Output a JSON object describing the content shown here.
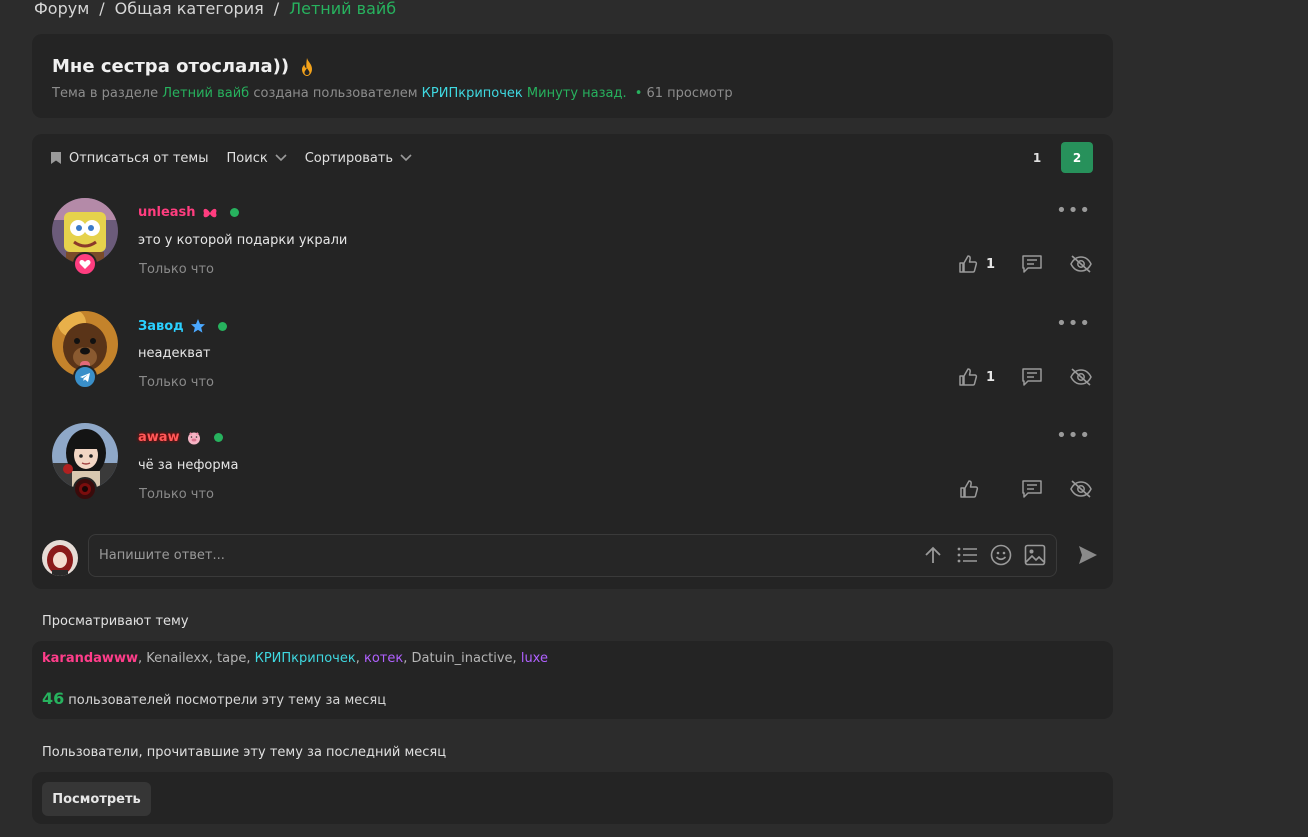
{
  "breadcrumb": {
    "home": "Форум",
    "category": "Общая категория",
    "current": "Летний вайб",
    "separator": "/"
  },
  "thread": {
    "title": "Мне сестра отослала))",
    "meta_prefix": "Тема в разделе",
    "section": "Летний вайб",
    "meta_mid": "создана пользователем",
    "author": "КРИПкрипочек",
    "time": "Минуту назад.",
    "dot": "•",
    "views": "61 просмотр"
  },
  "toolbar": {
    "unsubscribe": "Отписаться от темы",
    "search": "Поиск",
    "sort": "Сортировать"
  },
  "pager": {
    "pages": [
      "1",
      "2"
    ],
    "active": "2"
  },
  "posts": [
    {
      "username": "unleash",
      "text": "это у которой подарки украли",
      "time": "Только что",
      "likes": "1",
      "name_color": "#ff3d7f"
    },
    {
      "username": "Завод",
      "text": "неадекват",
      "time": "Только что",
      "likes": "1",
      "name_color": "#2ad0ff"
    },
    {
      "username": "awaw",
      "text": "чё за неформа",
      "time": "Только что",
      "likes": "",
      "name_color": "#ff5a5a"
    }
  ],
  "reply": {
    "placeholder": "Напишите ответ..."
  },
  "viewers": {
    "label": "Просматривают тему",
    "users": [
      {
        "name": "karandawww",
        "color": "#ff3d8a"
      },
      {
        "name": "Kenailexx",
        "color": "#b5b5b5"
      },
      {
        "name": "tape",
        "color": "#b5b5b5"
      },
      {
        "name": "КРИПкрипочек",
        "color": "#3fd8e0"
      },
      {
        "name": "котек",
        "color": "#b061ff"
      },
      {
        "name": "Datuin_inactive",
        "color": "#b5b5b5"
      },
      {
        "name": "luxe",
        "color": "#b061ff"
      }
    ],
    "separator": ",",
    "month_count": "46",
    "month_text": "пользователей посмотрели эту тему за месяц"
  },
  "readers": {
    "label": "Пользователи, прочитавшие эту тему за последний месяц",
    "button": "Посмотреть"
  },
  "colors": {
    "accent": "#27b25e",
    "bg": "#2c2c2c",
    "card": "#242424"
  }
}
